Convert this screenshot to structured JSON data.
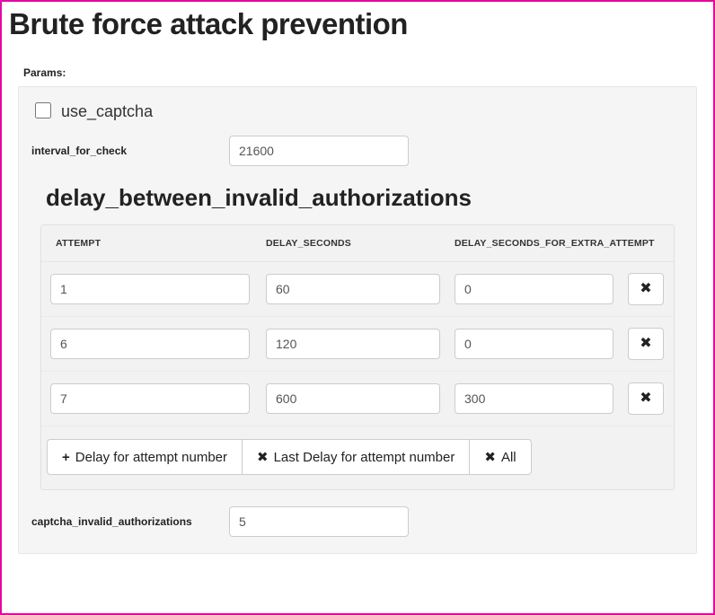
{
  "title": "Brute force attack prevention",
  "paramsLabel": "Params:",
  "useCaptcha": {
    "label": "use_captcha",
    "checked": false
  },
  "intervalForCheck": {
    "label": "interval_for_check",
    "value": "21600"
  },
  "delaySection": {
    "title": "delay_between_invalid_authorizations",
    "columns": {
      "attempt": "ATTEMPT",
      "delay": "DELAY_SECONDS",
      "extra": "DELAY_SECONDS_FOR_EXTRA_ATTEMPT"
    },
    "rows": [
      {
        "attempt": "1",
        "delay": "60",
        "extra": "0"
      },
      {
        "attempt": "6",
        "delay": "120",
        "extra": "0"
      },
      {
        "attempt": "7",
        "delay": "600",
        "extra": "300"
      }
    ],
    "actions": {
      "add": "Delay for attempt number",
      "removeLast": "Last Delay for attempt number",
      "removeAll": "All"
    }
  },
  "captchaInvalidAuth": {
    "label": "captcha_invalid_authorizations",
    "value": "5"
  }
}
